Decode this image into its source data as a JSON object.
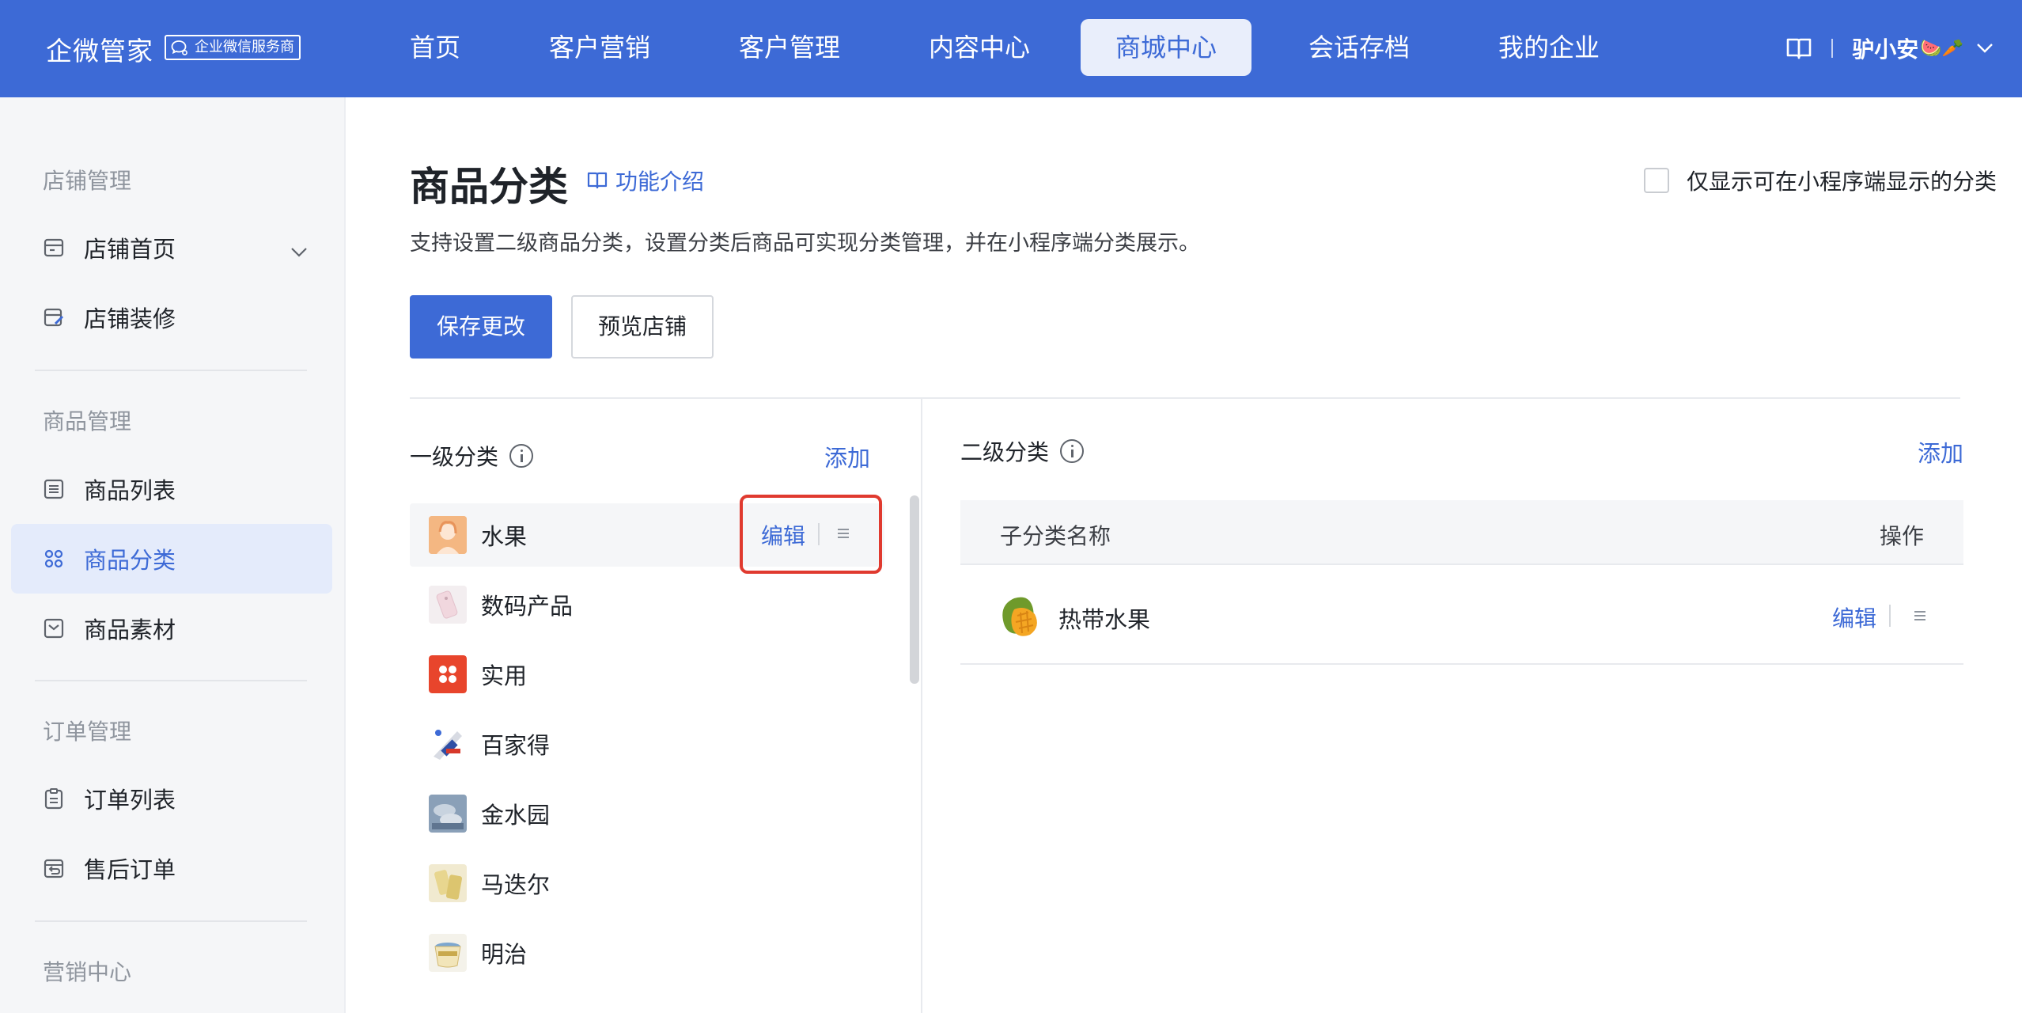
{
  "topbar": {
    "logo": "企微管家",
    "badge": "企业微信服务商",
    "nav": [
      "首页",
      "客户营销",
      "客户管理",
      "内容中心",
      "商城中心",
      "会话存档",
      "我的企业"
    ],
    "active_nav": "商城中心",
    "user_name": "驴小安",
    "user_emoji": "🍉🥕"
  },
  "sidebar": {
    "groups": {
      "store": "店铺管理",
      "goods": "商品管理",
      "orders": "订单管理",
      "marketing": "营销中心"
    },
    "items": {
      "store_home": "店铺首页",
      "store_decor": "店铺装修",
      "goods_list": "商品列表",
      "goods_category": "商品分类",
      "goods_material": "商品素材",
      "order_list": "订单列表",
      "after_sale": "售后订单"
    }
  },
  "page": {
    "title": "商品分类",
    "intro_link": "功能介绍",
    "description": "支持设置二级商品分类，设置分类后商品可实现分类管理，并在小程序端分类展示。",
    "only_show_label": "仅显示可在小程序端显示的分类",
    "save_button": "保存更改",
    "preview_button": "预览店铺"
  },
  "level1": {
    "title": "一级分类",
    "add": "添加",
    "edit": "编辑",
    "categories": [
      "水果",
      "数码产品",
      "实用",
      "百家得",
      "金水园",
      "马迭尔",
      "明治"
    ]
  },
  "level2": {
    "title": "二级分类",
    "add": "添加",
    "col_name": "子分类名称",
    "col_op": "操作",
    "rows": [
      {
        "name": "热带水果",
        "edit": "编辑"
      }
    ]
  }
}
